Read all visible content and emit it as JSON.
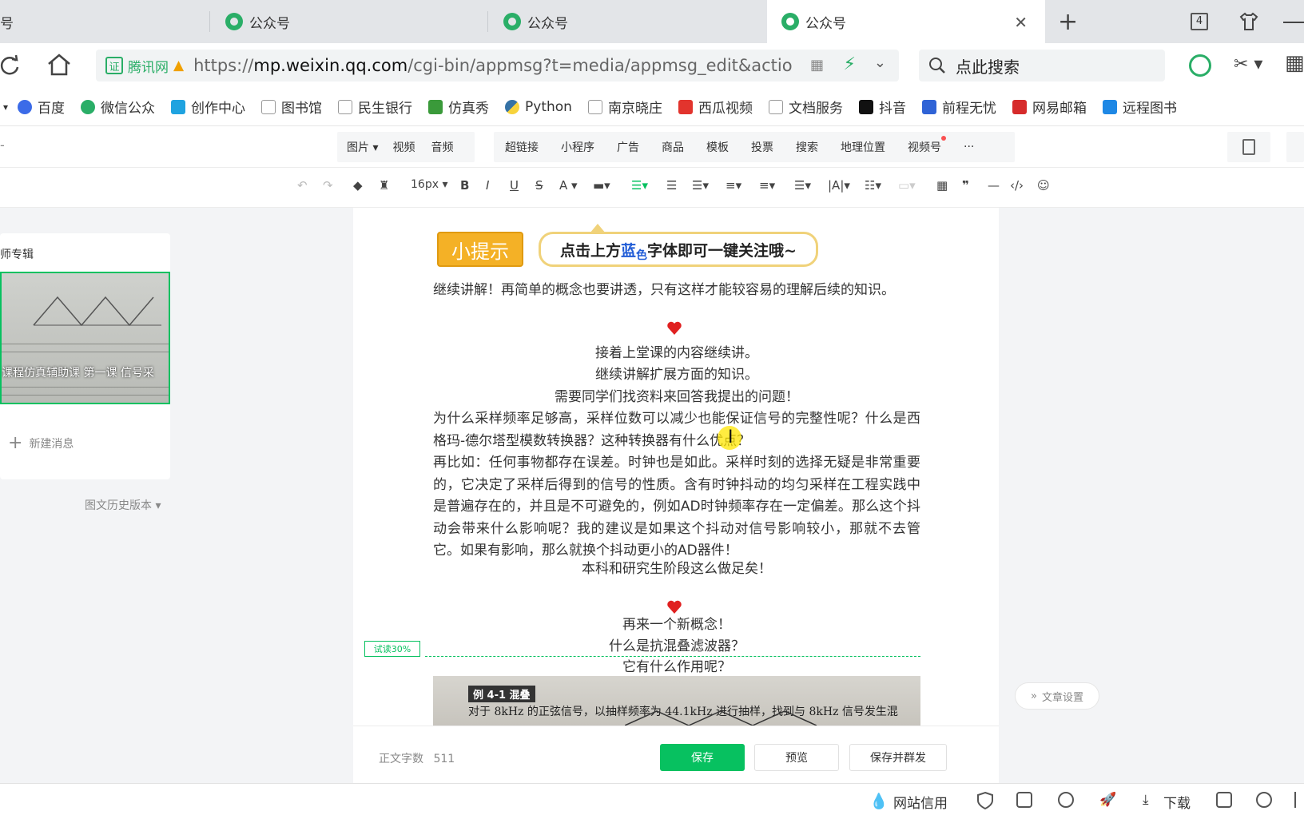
{
  "browser": {
    "tabs": [
      {
        "label": "号"
      },
      {
        "label": "公众号"
      },
      {
        "label": "公众号"
      },
      {
        "label": "公众号"
      }
    ],
    "tab_count": "4",
    "url_prefix": "https://",
    "url_host": "mp.weixin.qq.com",
    "url_path": "/cgi-bin/appmsg?t=media/appmsg_edit&actio",
    "site_badge": "腾讯网",
    "search_placeholder": "点此搜索",
    "bookmarks": [
      "百度",
      "微信公众",
      "创作中心",
      "图书馆",
      "民生银行",
      "仿真秀",
      "Python",
      "南京晓庄",
      "西瓜视频",
      "文档服务",
      "抖音",
      "前程无忧",
      "网易邮箱",
      "远程图书"
    ]
  },
  "editor": {
    "toolbar_left": [
      "图片",
      "视频",
      "音频"
    ],
    "toolbar_right": [
      "超链接",
      "小程序",
      "广告",
      "商品",
      "模板",
      "投票",
      "搜索",
      "地理位置",
      "视频号",
      "···"
    ],
    "font_size": "16px",
    "format_icons": [
      "B",
      "I",
      "U",
      "S",
      "A"
    ]
  },
  "left_panel": {
    "heading": "师专辑",
    "thumb_title": "课程仿真辅助课 第一课 信号采",
    "new_message": "新建消息",
    "history": "图文历史版本"
  },
  "article": {
    "tip_label": "小提示",
    "tip_text_a": "点击上方",
    "tip_blue": "蓝",
    "tip_blue2": "色",
    "tip_text_b": "字体即可一键关注哦~",
    "p1": "继续讲解！再简单的概念也要讲透，只有这样才能较容易的理解后续的知识。",
    "c1": "接着上堂课的内容继续讲。",
    "c2": "继续讲解扩展方面的知识。",
    "c3": "需要同学们找资料来回答我提出的问题！",
    "p2": "为什么采样频率足够高，采样位数可以减少也能保证信号的完整性呢？什么是西格玛-德尔塔型模数转换器？这种转换器有什么优点？",
    "p3": "再比如：任何事物都存在误差。时钟也是如此。采样时刻的选择无疑是非常重要的，它决定了采样后得到的信号的性质。含有时钟抖动的均匀采样在工程实践中是普遍存在的，并且是不可避免的，例如AD时钟频率存在一定偏差。那么这个抖动会带来什么影响呢？我的建议是如果这个抖动对信号影响较小，那就不去管它。如果有影响，那么就换个抖动更小的AD器件！",
    "c4": "本科和研究生阶段这么做足矣！",
    "c5": "再来一个新概念！",
    "c6": "什么是抗混叠滤波器？",
    "c7": "它有什么作用呢？",
    "trial_badge": "试读30%",
    "image_caption": "例 4-1  混叠",
    "image_text": "对于 8kHz 的正弦信号，以抽样频率为 44.1kHz 进行抽样，找到与 8kHz 信号发生混"
  },
  "footer": {
    "word_count_label": "正文字数",
    "word_count": "511",
    "save": "保存",
    "preview": "预览",
    "save_send": "保存并群发",
    "article_settings": "文章设置"
  },
  "status": {
    "site_credit": "网站信用",
    "download": "下载"
  }
}
